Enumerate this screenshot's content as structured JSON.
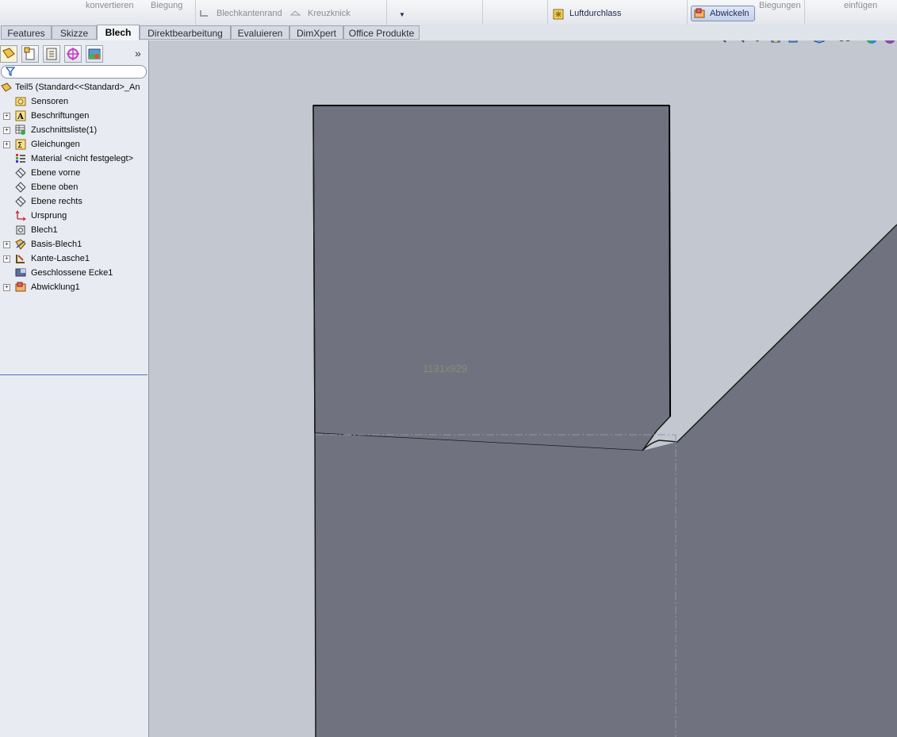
{
  "ribbon": {
    "konvertieren": "konvertieren",
    "biegung": "Biegung",
    "blechkantenrand": "Blechkantenrand",
    "kreuzknick": "Kreuzknick",
    "luftdurchlass": "Luftdurchlass",
    "abwickeln": "Abwickeln",
    "biegungen": "Biegungen",
    "einfuegen": "einfügen"
  },
  "tabs": [
    "Features",
    "Skizze",
    "Blech",
    "Direktbearbeitung",
    "Evaluieren",
    "DimXpert",
    "Office Produkte"
  ],
  "active_tab": "Blech",
  "tree": {
    "root": "Teil5  (Standard<<Standard>_An",
    "items": [
      {
        "label": "Sensoren",
        "expandable": false,
        "icon": "sensor-icon"
      },
      {
        "label": "Beschriftungen",
        "expandable": true,
        "icon": "annotation-icon"
      },
      {
        "label": "Zuschnittsliste(1)",
        "expandable": true,
        "icon": "cutlist-icon"
      },
      {
        "label": "Gleichungen",
        "expandable": true,
        "icon": "equation-icon"
      },
      {
        "label": "Material <nicht festgelegt>",
        "expandable": false,
        "icon": "material-icon"
      },
      {
        "label": "Ebene vorne",
        "expandable": false,
        "icon": "plane-icon"
      },
      {
        "label": "Ebene oben",
        "expandable": false,
        "icon": "plane-icon"
      },
      {
        "label": "Ebene rechts",
        "expandable": false,
        "icon": "plane-icon"
      },
      {
        "label": "Ursprung",
        "expandable": false,
        "icon": "origin-icon"
      },
      {
        "label": "Blech1",
        "expandable": false,
        "icon": "sheetmetal-icon"
      },
      {
        "label": "Basis-Blech1",
        "expandable": true,
        "icon": "base-flange-icon"
      },
      {
        "label": "Kante-Lasche1",
        "expandable": true,
        "icon": "edge-flange-icon"
      },
      {
        "label": "Geschlossene Ecke1",
        "expandable": false,
        "icon": "closed-corner-icon"
      },
      {
        "label": "Abwicklung1",
        "expandable": true,
        "icon": "flatpattern-icon"
      }
    ]
  },
  "viewport": {
    "dimension_text": "1131x929",
    "part_color": "#70737f",
    "background_color": "#c3c7cf"
  }
}
